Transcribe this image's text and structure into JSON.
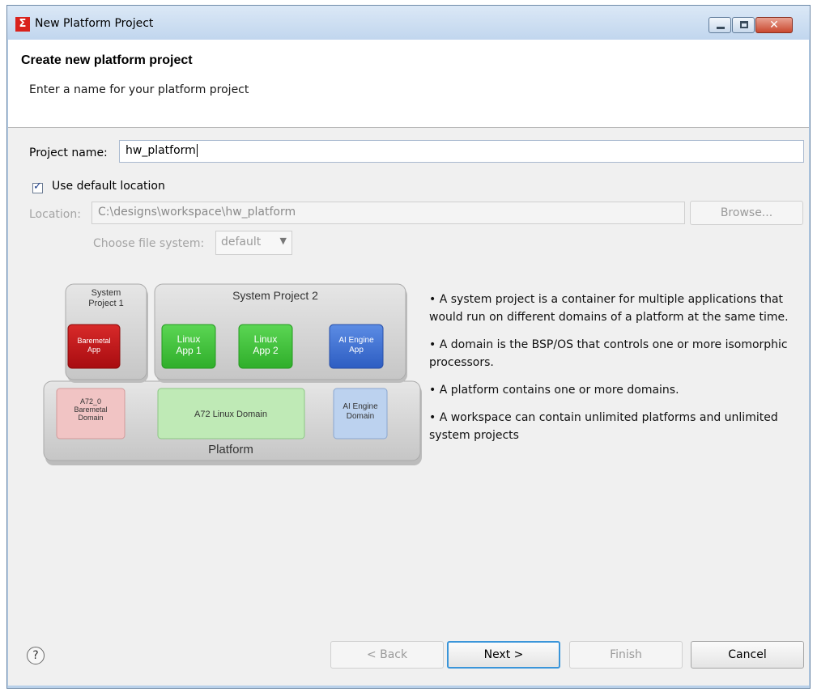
{
  "window": {
    "title": "New Platform Project",
    "app_icon": "xilinx-logo-icon"
  },
  "header": {
    "title": "Create new platform project",
    "subtitle": "Enter a name for your platform project"
  },
  "form": {
    "project_name_label": "Project name:",
    "project_name_value": "hw_platform",
    "use_default_location_label": "Use default location",
    "use_default_location_checked": true,
    "location_label": "Location:",
    "location_value": "C:\\designs\\workspace\\hw_platform",
    "browse_label": "Browse...",
    "file_system_label": "Choose file system:",
    "file_system_value": "default"
  },
  "diagram": {
    "system_project_1": "System Project 1",
    "system_project_2": "System Project 2",
    "baremetal_app": "Baremetal App",
    "linux_app_1": "Linux App 1",
    "linux_app_2": "Linux App 2",
    "ai_engine_app": "AI Engine App",
    "a72_baremetal_domain": "A72_0 Baremetal Domain",
    "a72_linux_domain": "A72 Linux Domain",
    "ai_engine_domain": "AI Engine Domain",
    "platform": "Platform",
    "colors": {
      "baremetal_app": "#c4141a",
      "linux_app": "#3fc23a",
      "ai_engine_app": "#3f73d4",
      "baremetal_domain": "#f1c4c4",
      "linux_domain": "#bfeab6",
      "ai_engine_domain": "#bcd2ef"
    }
  },
  "bullets": [
    "• A system project is a container for multiple applications that would run on different domains of a platform at the same time.",
    "• A domain is the BSP/OS that controls one or more isomorphic processors.",
    "• A platform contains one or more domains.",
    "• A workspace can contain unlimited platforms and unlimited system projects"
  ],
  "footer": {
    "help_icon": "help-icon",
    "back_label": "< Back",
    "next_label": "Next >",
    "finish_label": "Finish",
    "cancel_label": "Cancel"
  }
}
